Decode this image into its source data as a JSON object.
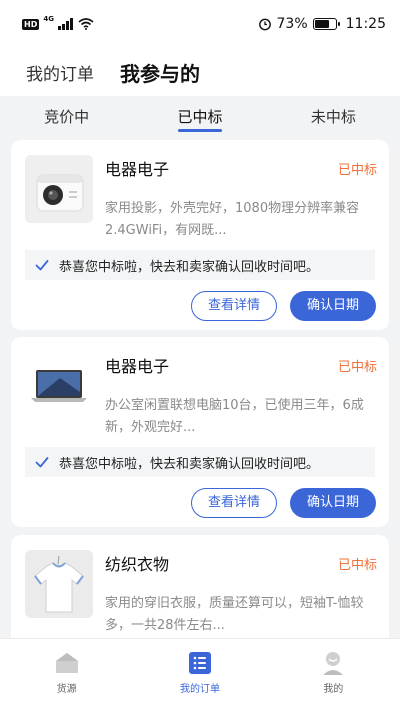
{
  "status_bar": {
    "hd": "HD",
    "network": "4G",
    "battery_percent": "73%",
    "battery_level": 0.73,
    "time": "11:25"
  },
  "header": {
    "tabs": [
      {
        "label": "我的订单",
        "active": false
      },
      {
        "label": "我参与的",
        "active": true
      }
    ]
  },
  "sub_tabs": [
    {
      "label": "竞价中",
      "active": false
    },
    {
      "label": "已中标",
      "active": true
    },
    {
      "label": "未中标",
      "active": false
    }
  ],
  "orders": [
    {
      "category": "电器电子",
      "status": "已中标",
      "description": "家用投影，外壳完好，1080物理分辨率兼容2.4GWiFi，有网既...",
      "notice": "恭喜您中标啦，快去和卖家确认回收时间吧。",
      "detail_label": "查看详情",
      "confirm_label": "确认日期",
      "image": "projector"
    },
    {
      "category": "电器电子",
      "status": "已中标",
      "description": "办公室闲置联想电脑10台，已使用三年，6成新，外观完好...",
      "notice": "恭喜您中标啦，快去和卖家确认回收时间吧。",
      "detail_label": "查看详情",
      "confirm_label": "确认日期",
      "image": "laptop"
    },
    {
      "category": "纺织衣物",
      "status": "已中标",
      "description": "家用的穿旧衣服，质量还算可以，短袖T-恤较多，一共28件左右...",
      "image": "tshirt"
    }
  ],
  "bottom_nav": [
    {
      "label": "货源",
      "icon": "home-icon",
      "active": false
    },
    {
      "label": "我的订单",
      "icon": "order-list-icon",
      "active": true
    },
    {
      "label": "我的",
      "icon": "profile-icon",
      "active": false
    }
  ],
  "colors": {
    "accent": "#3b66d8",
    "status_orange": "#f0703a",
    "background": "#f2f3f5"
  }
}
